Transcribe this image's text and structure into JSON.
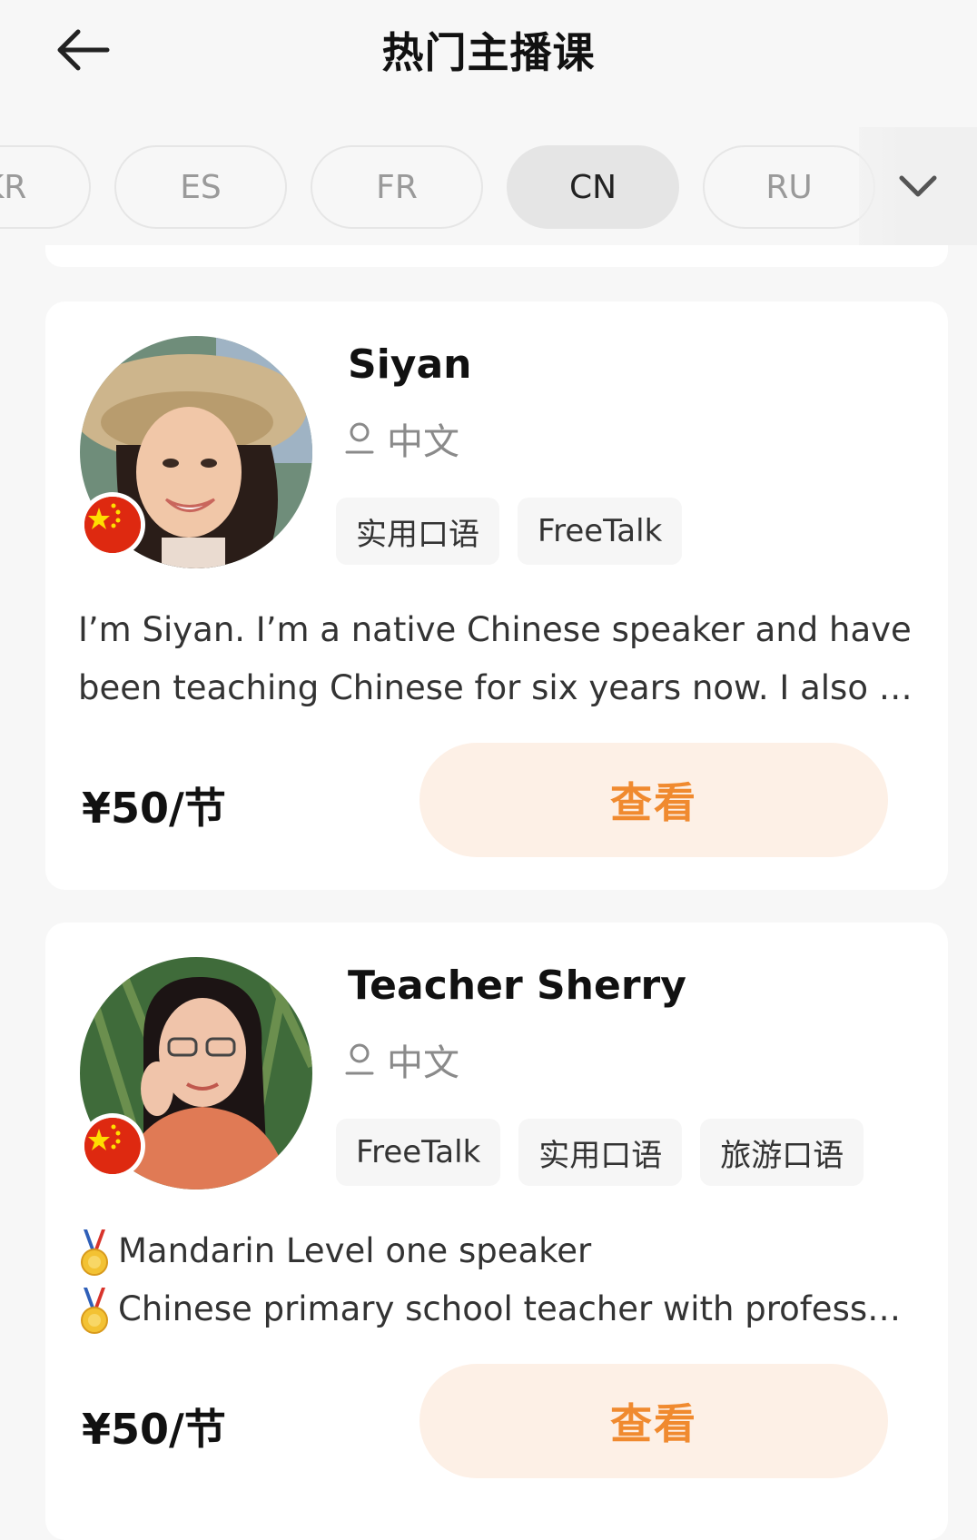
{
  "header": {
    "title": "热门主播课"
  },
  "tabs": [
    {
      "label": "KR",
      "active": false
    },
    {
      "label": "ES",
      "active": false
    },
    {
      "label": "FR",
      "active": false
    },
    {
      "label": "CN",
      "active": true
    },
    {
      "label": "RU",
      "active": false
    }
  ],
  "teachers": [
    {
      "name": "Siyan",
      "language": "中文",
      "tags": [
        "实用口语",
        "FreeTalk"
      ],
      "description": [
        "I’m Siyan. I’m a native Chinese speaker and have",
        "been teaching Chinese for six years now. I also …"
      ],
      "price": "¥50/节",
      "button": "查看"
    },
    {
      "name": "Teacher Sherry",
      "language": "中文",
      "tags": [
        "FreeTalk",
        "实用口语",
        "旅游口语"
      ],
      "description": [
        "Mandarin Level one speaker",
        "Chinese primary school teacher with profess…"
      ],
      "price": "¥50/节",
      "button": "查看"
    }
  ],
  "colors": {
    "accent": "#f08a2f",
    "button_bg": "#fdf0e6",
    "flag_red": "#de2910",
    "flag_yellow": "#ffde00"
  },
  "icons": {
    "back": "arrow-left-icon",
    "expand": "chevron-down-icon",
    "language": "person-icon",
    "medal": "medal-icon",
    "flag": "china-flag-icon"
  }
}
